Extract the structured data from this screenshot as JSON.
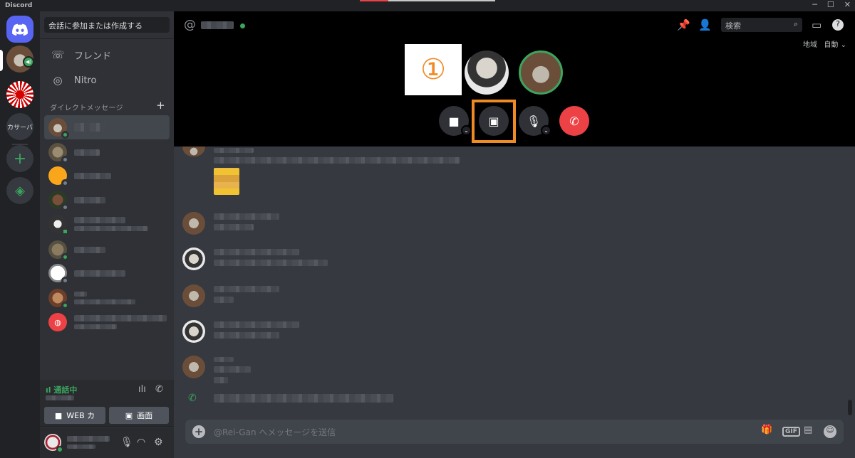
{
  "app": {
    "title": "Discord",
    "window_controls": [
      "─",
      "☐",
      "✕"
    ]
  },
  "rail": {
    "text_server": "カサーバ"
  },
  "sidebar": {
    "search_placeholder": "会話に参加または作成する",
    "nav": [
      {
        "label": "フレンド",
        "icon": "friends-icon"
      },
      {
        "label": "Nitro",
        "icon": "nitro-icon"
      }
    ],
    "dm_header": "ダイレクトメッセージ",
    "dm_add": "+"
  },
  "voice": {
    "status": "通話中",
    "video_label": "WEB カ",
    "screen_label": "画面"
  },
  "header": {
    "at_symbol": "@",
    "search_placeholder": "検索",
    "region_label": "地域",
    "region_value": "自動"
  },
  "call": {
    "step_number": "①"
  },
  "composer": {
    "placeholder": "@Rei-Gan へメッセージを送信",
    "gif_label": "GIF"
  },
  "colors": {
    "brand": "#5865f2",
    "online": "#3ba55d",
    "hangup": "#ed4245",
    "highlight": "#f08a24"
  }
}
